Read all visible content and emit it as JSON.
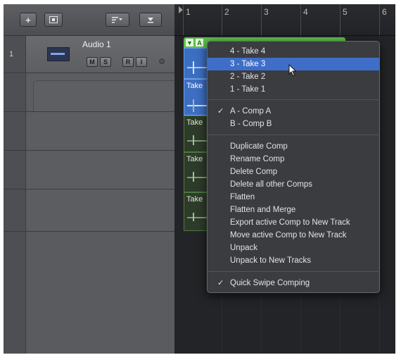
{
  "toolbar": {
    "add_label": "+",
    "buttons": [
      "add-track",
      "track-settings",
      "filter",
      "catch"
    ]
  },
  "track": {
    "number": "1",
    "name": "Audio 1",
    "buttons": [
      "M",
      "S",
      "R",
      "I"
    ]
  },
  "ruler": {
    "bars": [
      "1",
      "2",
      "3",
      "4",
      "5",
      "6"
    ]
  },
  "region": {
    "header_icons": [
      "▼",
      "A"
    ],
    "take_label": "Take"
  },
  "menu": {
    "takes": [
      {
        "label": "4 - Take 4"
      },
      {
        "label": "3 - Take 3",
        "highlighted": true
      },
      {
        "label": "2 - Take 2"
      },
      {
        "label": "1 - Take 1"
      }
    ],
    "comps": [
      {
        "label": "A - Comp A",
        "checked": true
      },
      {
        "label": "B - Comp B"
      }
    ],
    "actions": [
      {
        "label": "Duplicate Comp"
      },
      {
        "label": "Rename Comp"
      },
      {
        "label": "Delete Comp"
      },
      {
        "label": "Delete all other Comps"
      },
      {
        "label": "Flatten"
      },
      {
        "label": "Flatten and Merge"
      },
      {
        "label": "Export active Comp to New Track"
      },
      {
        "label": "Move active Comp to New Track"
      },
      {
        "label": "Unpack"
      },
      {
        "label": "Unpack to New Tracks"
      }
    ],
    "options": [
      {
        "label": "Quick Swipe Comping",
        "checked": true
      }
    ],
    "check_mark": "✓"
  },
  "colors": {
    "region_green": "#5cc14a",
    "selected_blue": "#3f6ec8"
  }
}
